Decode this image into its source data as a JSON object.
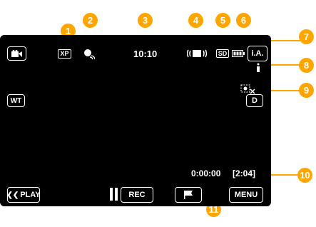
{
  "callouts": [
    "1",
    "2",
    "3",
    "4",
    "5",
    "6",
    "7",
    "8",
    "9",
    "10",
    "11"
  ],
  "status": {
    "quality": "XP",
    "time": "10:10",
    "media": "SD",
    "mode": "i.A.",
    "elapsed": "0:00:00",
    "remaining": "[2:04]"
  },
  "buttons": {
    "wt": "WT",
    "d": "D",
    "play": "PLAY",
    "rec": "REC",
    "menu": "MENU"
  },
  "icons": [
    "video-mode-icon",
    "wifi-face-icon",
    "image-stabilizer-icon",
    "sd-card-icon",
    "battery-icon",
    "lighting-icon",
    "face-priority-icon",
    "pause-icon",
    "flag-icon",
    "back-chevron-icon"
  ],
  "colors": {
    "callout": "#ffa500",
    "screen": "#000000"
  }
}
